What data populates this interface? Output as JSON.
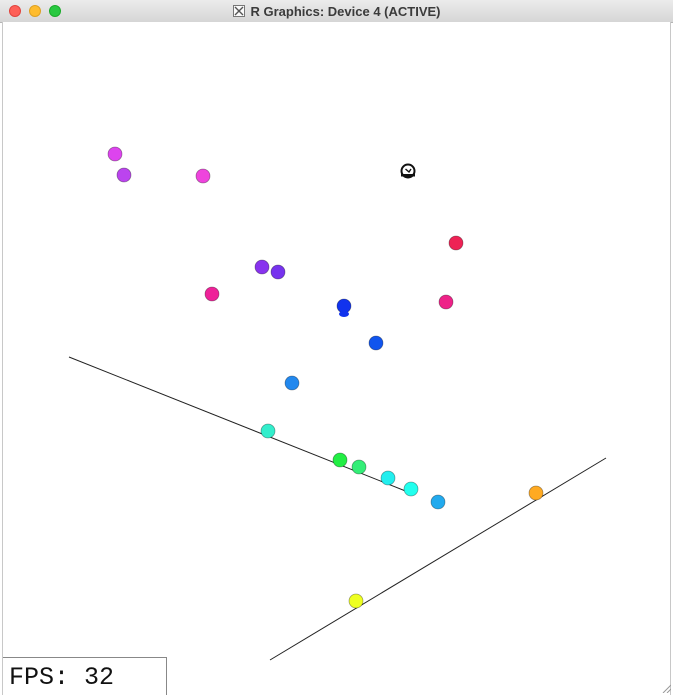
{
  "window": {
    "title": "R Graphics: Device 4 (ACTIVE)",
    "title_icon": "x11-icon",
    "traffic_lights": {
      "close": "#fe5f57",
      "minimize": "#febc2e",
      "zoom": "#28c840"
    }
  },
  "fps": {
    "label": "FPS:",
    "value": "32"
  },
  "scene": {
    "balls": [
      {
        "color": "#dd44ee"
      },
      {
        "color": "#bb44ee"
      },
      {
        "color": "#ee44dd"
      },
      {
        "color": "#8833ee"
      },
      {
        "color": "#7733ee"
      },
      {
        "color": "#ee2299"
      },
      {
        "color": "#1133ee"
      },
      {
        "color": "#1155ee"
      },
      {
        "color": "#ee2255"
      },
      {
        "color": "#ee2288"
      },
      {
        "color": "#2288ee"
      },
      {
        "color": "#33eecc"
      },
      {
        "color": "#22ee44"
      },
      {
        "color": "#33ee77"
      },
      {
        "color": "#22eeee"
      },
      {
        "color": "#22ffee"
      },
      {
        "color": "#22aaee"
      },
      {
        "color": "#ffaa22"
      },
      {
        "color": "#eeff22"
      }
    ],
    "cursor_icon": "mouse-cursor-icon"
  }
}
